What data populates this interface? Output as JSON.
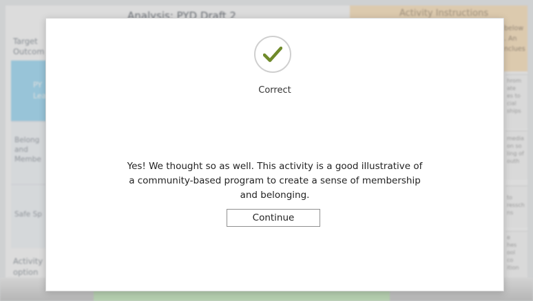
{
  "background": {
    "page_title": "Analysis: PYD Draft 2",
    "instructions_title": "Activity Instructions",
    "instructions_snippet": "below\n. An\nnclues",
    "target_label": "Target\nOutcom",
    "pyd_label": "PY\nLea",
    "rows": [
      {
        "label": "Belong\nand\nMembe"
      },
      {
        "label": "Safe Sp"
      }
    ],
    "activity_label": "Activity\noption\ndo not",
    "right_snippets": [
      "hrom\nate\nes to\ncial\nships",
      "media\non so\nling of\nouth",
      "to\nressch\nns",
      "e\nhes\nool\nco\nition"
    ]
  },
  "modal": {
    "status_icon": "check-icon",
    "status_text": "Correct",
    "message": "Yes! We thought so as well. This activity is a good illustrative of a community-based program to create a sense of membership and belonging.",
    "continue_label": "Continue"
  },
  "colors": {
    "check": "#6f8a2a",
    "instructions_bg": "#fbe6c7",
    "pyd_bg": "#aee0f6"
  }
}
